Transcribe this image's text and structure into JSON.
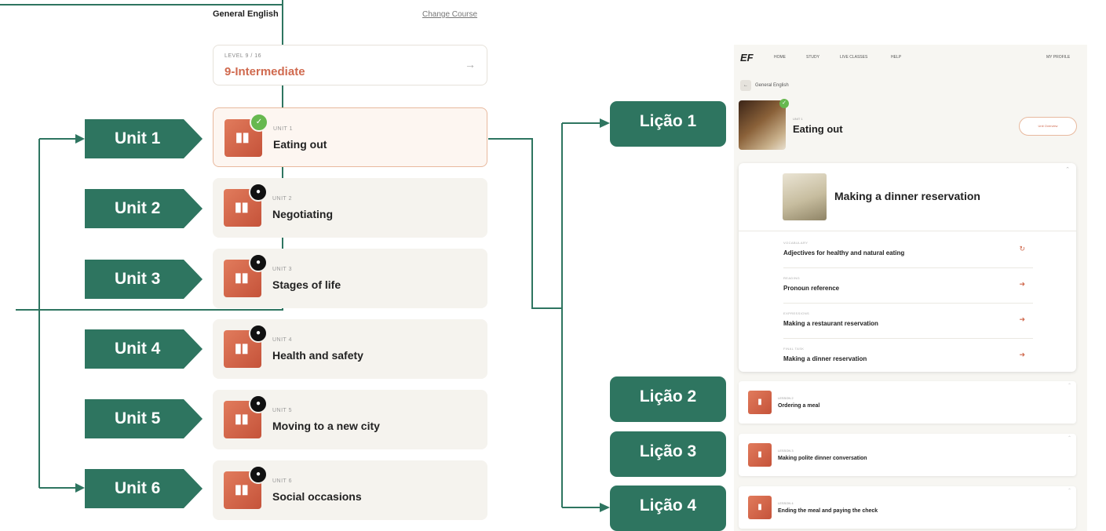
{
  "left": {
    "course_title": "General English",
    "change_course": "Change Course",
    "level_label": "LEVEL 9 / 16",
    "level_name": "9-Intermediate",
    "units": [
      {
        "tag": "Unit 1",
        "label": "UNIT 1",
        "title": "Eating out",
        "status": "in-progress"
      },
      {
        "tag": "Unit 2",
        "label": "UNIT 2",
        "title": "Negotiating",
        "status": "locked"
      },
      {
        "tag": "Unit 3",
        "label": "UNIT 3",
        "title": "Stages of life",
        "status": "locked"
      },
      {
        "tag": "Unit 4",
        "label": "UNIT 4",
        "title": "Health and safety",
        "status": "locked"
      },
      {
        "tag": "Unit 5",
        "label": "UNIT 5",
        "title": "Moving to a new city",
        "status": "locked"
      },
      {
        "tag": "Unit 6",
        "label": "UNIT 6",
        "title": "Social occasions",
        "status": "locked"
      }
    ]
  },
  "right": {
    "logo": "EF",
    "nav": [
      "HOME",
      "STUDY",
      "LIVE CLASSES",
      "HELP"
    ],
    "profile": "MY PROFILE",
    "breadcrumb": "General English",
    "unit_label": "UNIT 1",
    "unit_title": "Eating out",
    "unit_button": "Unit Overview",
    "lesson_tags": [
      "Lição 1",
      "Lição 2",
      "Lição 3",
      "Lição 4"
    ],
    "lesson1": {
      "title": "Making a dinner reservation",
      "activities": [
        {
          "label": "VOCABULARY",
          "title": "Adjectives for healthy and natural eating"
        },
        {
          "label": "READING",
          "title": "Pronoun reference"
        },
        {
          "label": "EXPRESSIONS",
          "title": "Making a restaurant reservation"
        },
        {
          "label": "FINAL TASK",
          "title": "Making a dinner reservation"
        }
      ]
    },
    "lessons": [
      {
        "label": "LESSON 2",
        "title": "Ordering a meal"
      },
      {
        "label": "LESSON 3",
        "title": "Making polite dinner conversation"
      },
      {
        "label": "LESSON 4",
        "title": "Ending the meal and paying the check"
      }
    ]
  },
  "colors": {
    "tag_green": "#2e7560",
    "accent_orange": "#d06a4f",
    "card_bg": "#f5f3ee",
    "lock": "#111111",
    "check_green": "#67b84f"
  },
  "icons": {
    "thumb": "music-bars-icon",
    "lock": "lock-icon",
    "check": "check-icon",
    "arrow": "arrow-right-icon"
  }
}
